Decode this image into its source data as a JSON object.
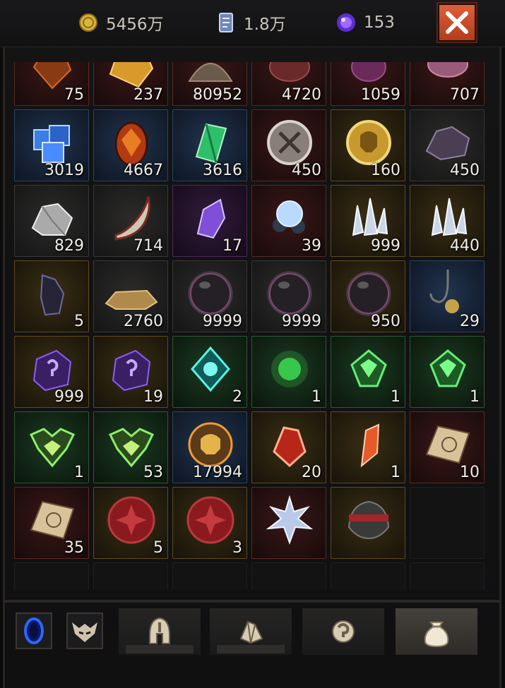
{
  "currencies": [
    {
      "name": "gold",
      "value": "5456万",
      "icon": "gold-coin-icon"
    },
    {
      "name": "card",
      "value": "1.8万",
      "icon": "card-icon"
    },
    {
      "name": "gem",
      "value": "153",
      "icon": "purple-orb-icon"
    }
  ],
  "close": {
    "icon": "close-icon",
    "color": "#d24d2a"
  },
  "inventory": [
    {
      "icon": "ore-orange",
      "qty": "75",
      "q": "red"
    },
    {
      "icon": "gold-chunk",
      "qty": "237",
      "q": "red"
    },
    {
      "icon": "bone-pile",
      "qty": "80952",
      "q": "red"
    },
    {
      "icon": "flesh",
      "qty": "4720",
      "q": "red"
    },
    {
      "icon": "purple-flesh",
      "qty": "1059",
      "q": "red"
    },
    {
      "icon": "pink-flesh",
      "qty": "707",
      "q": "red"
    },
    {
      "icon": "blue-cubes",
      "qty": "3019",
      "q": "blue"
    },
    {
      "icon": "fire-egg",
      "qty": "4667",
      "q": "blue"
    },
    {
      "icon": "green-crystal",
      "qty": "3616",
      "q": "blue"
    },
    {
      "icon": "silver-crest-coin",
      "qty": "450",
      "q": "red"
    },
    {
      "icon": "gold-skull-coin",
      "qty": "160",
      "q": "yellow"
    },
    {
      "icon": "iron-ore",
      "qty": "450",
      "q": "gray"
    },
    {
      "icon": "silver-ore",
      "qty": "829",
      "q": "gray"
    },
    {
      "icon": "horn",
      "qty": "714",
      "q": "gray"
    },
    {
      "icon": "amethyst",
      "qty": "17",
      "q": "purple"
    },
    {
      "icon": "pearl-cluster",
      "qty": "39",
      "q": "red"
    },
    {
      "icon": "ice-shards",
      "qty": "999",
      "q": "yellow"
    },
    {
      "icon": "ice-shards",
      "qty": "440",
      "q": "yellow"
    },
    {
      "icon": "dark-helm-shard",
      "qty": "5",
      "q": "yellow"
    },
    {
      "icon": "sand-pile",
      "qty": "2760",
      "q": "gray"
    },
    {
      "icon": "dark-orb",
      "qty": "9999",
      "q": "gray"
    },
    {
      "icon": "dark-orb",
      "qty": "9999",
      "q": "gray"
    },
    {
      "icon": "dark-orb",
      "qty": "950",
      "q": "yellow"
    },
    {
      "icon": "fishing-hook",
      "qty": "29",
      "q": "blue"
    },
    {
      "icon": "purple-rune-stone",
      "qty": "999",
      "q": "yellow"
    },
    {
      "icon": "purple-rune-stone",
      "qty": "19",
      "q": "yellow"
    },
    {
      "icon": "teal-spirit",
      "qty": "2",
      "q": "green"
    },
    {
      "icon": "green-wisp",
      "qty": "1",
      "q": "green"
    },
    {
      "icon": "green-spirit",
      "qty": "1",
      "q": "green"
    },
    {
      "icon": "green-spirit",
      "qty": "1",
      "q": "green"
    },
    {
      "icon": "green-demon-sigil",
      "qty": "1",
      "q": "green"
    },
    {
      "icon": "green-demon-sigil",
      "qty": "53",
      "q": "green"
    },
    {
      "icon": "golden-skull-orb",
      "qty": "17994",
      "q": "blue"
    },
    {
      "icon": "ruby-shard",
      "qty": "20",
      "q": "yellow"
    },
    {
      "icon": "red-crystal",
      "qty": "1",
      "q": "yellow"
    },
    {
      "icon": "treasure-map",
      "qty": "10",
      "q": "red"
    },
    {
      "icon": "treasure-map",
      "qty": "35",
      "q": "red"
    },
    {
      "icon": "red-wax-seal",
      "qty": "5",
      "q": "yellow"
    },
    {
      "icon": "red-wax-seal",
      "qty": "3",
      "q": "yellow"
    },
    {
      "icon": "frost-flower",
      "qty": "",
      "q": "red"
    },
    {
      "icon": "bandit-helm",
      "qty": "",
      "q": "yellow"
    },
    {
      "icon": "",
      "qty": "",
      "q": "empty"
    },
    {
      "icon": "",
      "qty": "",
      "q": "empty"
    },
    {
      "icon": "",
      "qty": "",
      "q": "empty"
    },
    {
      "icon": "",
      "qty": "",
      "q": "empty"
    },
    {
      "icon": "",
      "qty": "",
      "q": "empty"
    },
    {
      "icon": "",
      "qty": "",
      "q": "empty"
    },
    {
      "icon": "",
      "qty": "",
      "q": "empty"
    }
  ],
  "bottom": {
    "buttons": [
      {
        "name": "portal-button",
        "icon": "blue-portal-icon"
      },
      {
        "name": "demon-mask-button",
        "icon": "demon-mask-icon"
      }
    ],
    "tabs": [
      {
        "name": "tab-equipment",
        "icon": "helmet-icon",
        "active": false
      },
      {
        "name": "tab-materials",
        "icon": "gem-icon",
        "active": false
      },
      {
        "name": "tab-runes",
        "icon": "rune-icon",
        "active": false
      },
      {
        "name": "tab-bag",
        "icon": "bag-icon",
        "active": true
      }
    ]
  }
}
